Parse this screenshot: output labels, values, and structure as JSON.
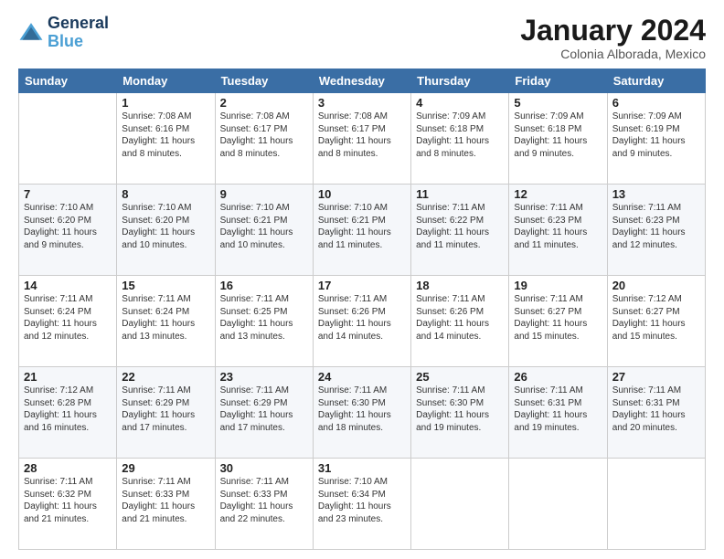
{
  "logo": {
    "line1": "General",
    "line2": "Blue"
  },
  "title": "January 2024",
  "subtitle": "Colonia Alborada, Mexico",
  "weekdays": [
    "Sunday",
    "Monday",
    "Tuesday",
    "Wednesday",
    "Thursday",
    "Friday",
    "Saturday"
  ],
  "weeks": [
    [
      {
        "day": "",
        "sunrise": "",
        "sunset": "",
        "daylight": ""
      },
      {
        "day": "1",
        "sunrise": "7:08 AM",
        "sunset": "6:16 PM",
        "daylight": "11 hours and 8 minutes."
      },
      {
        "day": "2",
        "sunrise": "7:08 AM",
        "sunset": "6:17 PM",
        "daylight": "11 hours and 8 minutes."
      },
      {
        "day": "3",
        "sunrise": "7:08 AM",
        "sunset": "6:17 PM",
        "daylight": "11 hours and 8 minutes."
      },
      {
        "day": "4",
        "sunrise": "7:09 AM",
        "sunset": "6:18 PM",
        "daylight": "11 hours and 8 minutes."
      },
      {
        "day": "5",
        "sunrise": "7:09 AM",
        "sunset": "6:18 PM",
        "daylight": "11 hours and 9 minutes."
      },
      {
        "day": "6",
        "sunrise": "7:09 AM",
        "sunset": "6:19 PM",
        "daylight": "11 hours and 9 minutes."
      }
    ],
    [
      {
        "day": "7",
        "sunrise": "7:10 AM",
        "sunset": "6:20 PM",
        "daylight": "11 hours and 9 minutes."
      },
      {
        "day": "8",
        "sunrise": "7:10 AM",
        "sunset": "6:20 PM",
        "daylight": "11 hours and 10 minutes."
      },
      {
        "day": "9",
        "sunrise": "7:10 AM",
        "sunset": "6:21 PM",
        "daylight": "11 hours and 10 minutes."
      },
      {
        "day": "10",
        "sunrise": "7:10 AM",
        "sunset": "6:21 PM",
        "daylight": "11 hours and 11 minutes."
      },
      {
        "day": "11",
        "sunrise": "7:11 AM",
        "sunset": "6:22 PM",
        "daylight": "11 hours and 11 minutes."
      },
      {
        "day": "12",
        "sunrise": "7:11 AM",
        "sunset": "6:23 PM",
        "daylight": "11 hours and 11 minutes."
      },
      {
        "day": "13",
        "sunrise": "7:11 AM",
        "sunset": "6:23 PM",
        "daylight": "11 hours and 12 minutes."
      }
    ],
    [
      {
        "day": "14",
        "sunrise": "7:11 AM",
        "sunset": "6:24 PM",
        "daylight": "11 hours and 12 minutes."
      },
      {
        "day": "15",
        "sunrise": "7:11 AM",
        "sunset": "6:24 PM",
        "daylight": "11 hours and 13 minutes."
      },
      {
        "day": "16",
        "sunrise": "7:11 AM",
        "sunset": "6:25 PM",
        "daylight": "11 hours and 13 minutes."
      },
      {
        "day": "17",
        "sunrise": "7:11 AM",
        "sunset": "6:26 PM",
        "daylight": "11 hours and 14 minutes."
      },
      {
        "day": "18",
        "sunrise": "7:11 AM",
        "sunset": "6:26 PM",
        "daylight": "11 hours and 14 minutes."
      },
      {
        "day": "19",
        "sunrise": "7:11 AM",
        "sunset": "6:27 PM",
        "daylight": "11 hours and 15 minutes."
      },
      {
        "day": "20",
        "sunrise": "7:12 AM",
        "sunset": "6:27 PM",
        "daylight": "11 hours and 15 minutes."
      }
    ],
    [
      {
        "day": "21",
        "sunrise": "7:12 AM",
        "sunset": "6:28 PM",
        "daylight": "11 hours and 16 minutes."
      },
      {
        "day": "22",
        "sunrise": "7:11 AM",
        "sunset": "6:29 PM",
        "daylight": "11 hours and 17 minutes."
      },
      {
        "day": "23",
        "sunrise": "7:11 AM",
        "sunset": "6:29 PM",
        "daylight": "11 hours and 17 minutes."
      },
      {
        "day": "24",
        "sunrise": "7:11 AM",
        "sunset": "6:30 PM",
        "daylight": "11 hours and 18 minutes."
      },
      {
        "day": "25",
        "sunrise": "7:11 AM",
        "sunset": "6:30 PM",
        "daylight": "11 hours and 19 minutes."
      },
      {
        "day": "26",
        "sunrise": "7:11 AM",
        "sunset": "6:31 PM",
        "daylight": "11 hours and 19 minutes."
      },
      {
        "day": "27",
        "sunrise": "7:11 AM",
        "sunset": "6:31 PM",
        "daylight": "11 hours and 20 minutes."
      }
    ],
    [
      {
        "day": "28",
        "sunrise": "7:11 AM",
        "sunset": "6:32 PM",
        "daylight": "11 hours and 21 minutes."
      },
      {
        "day": "29",
        "sunrise": "7:11 AM",
        "sunset": "6:33 PM",
        "daylight": "11 hours and 21 minutes."
      },
      {
        "day": "30",
        "sunrise": "7:11 AM",
        "sunset": "6:33 PM",
        "daylight": "11 hours and 22 minutes."
      },
      {
        "day": "31",
        "sunrise": "7:10 AM",
        "sunset": "6:34 PM",
        "daylight": "11 hours and 23 minutes."
      },
      {
        "day": "",
        "sunrise": "",
        "sunset": "",
        "daylight": ""
      },
      {
        "day": "",
        "sunrise": "",
        "sunset": "",
        "daylight": ""
      },
      {
        "day": "",
        "sunrise": "",
        "sunset": "",
        "daylight": ""
      }
    ]
  ]
}
